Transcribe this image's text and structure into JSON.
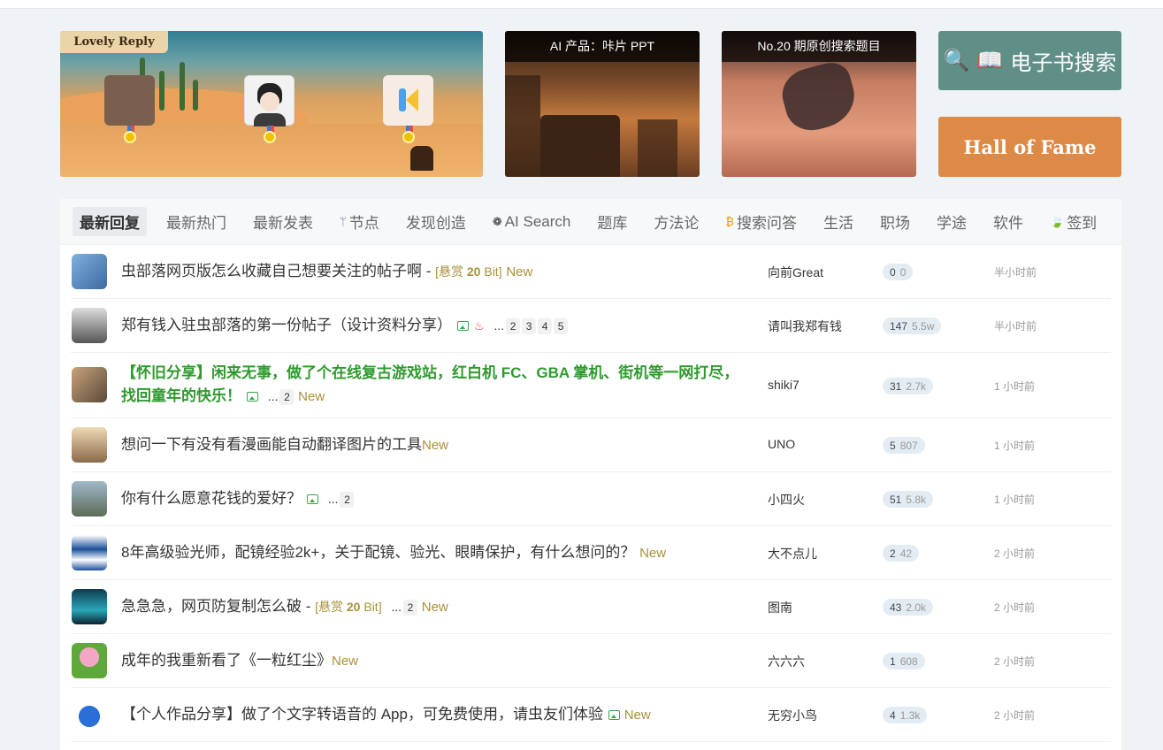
{
  "banners": {
    "main_tag": "Lovely Reply",
    "ai_caption": "AI 产品：咔片 PPT",
    "no20_caption": "No.20 期原创搜索题目"
  },
  "buttons": {
    "search_icon_glyph": "🔍",
    "book_icon_glyph": "📖",
    "ebook_search": "电子书搜索",
    "hall_of_fame": "Hall of Fame"
  },
  "tabs": [
    {
      "label": "最新回复",
      "icon": ""
    },
    {
      "label": "最新热门",
      "icon": ""
    },
    {
      "label": "最新发表",
      "icon": ""
    },
    {
      "label": "节点",
      "icon": "branch-icon",
      "glyph": "ᛘ"
    },
    {
      "label": "发现创造",
      "icon": ""
    },
    {
      "label": "AI Search",
      "icon": "ai-icon",
      "glyph": "❁"
    },
    {
      "label": "题库",
      "icon": ""
    },
    {
      "label": "方法论",
      "icon": ""
    },
    {
      "label": "搜索问答",
      "icon": "bitcoin-icon",
      "glyph": "₿"
    },
    {
      "label": "生活",
      "icon": ""
    },
    {
      "label": "职场",
      "icon": ""
    },
    {
      "label": "学途",
      "icon": ""
    },
    {
      "label": "软件",
      "icon": ""
    },
    {
      "label": "签到",
      "icon": "leaf-icon",
      "glyph": "🍃"
    }
  ],
  "colors": {
    "accent_green": "#5f8f86",
    "accent_orange": "#dd8a47",
    "featured_title": "#2e9a2e",
    "new_tag": "#a8913a"
  },
  "topics": [
    {
      "title": "虫部落网页版怎么收藏自己想要关注的帖子啊 - ",
      "bounty_pre": "[悬赏 ",
      "bounty_amt": "20",
      "bounty_post": " Bit]",
      "new": "New",
      "author": "向前Great",
      "replies": "0",
      "views": "0",
      "time": "半小时前"
    },
    {
      "title": "郑有钱入驻虫部落的第一份帖子（设计资料分享）",
      "dots": "...",
      "pages": [
        "2",
        "3",
        "4",
        "5"
      ],
      "author": "请叫我郑有钱",
      "replies": "147",
      "views": "5.5w",
      "time": "半小时前"
    },
    {
      "title": "【怀旧分享】闲来无事，做了个在线复古游戏站，红白机 FC、GBA 掌机、街机等一网打尽，找回童年的快乐！",
      "dots": "...",
      "pages": [
        "2"
      ],
      "new": "New",
      "author": "shiki7",
      "replies": "31",
      "views": "2.7k",
      "time": "1 小时前"
    },
    {
      "title": "想问一下有没有看漫画能自动翻译图片的工具",
      "new": "New",
      "author": "UNO",
      "replies": "5",
      "views": "807",
      "time": "1 小时前"
    },
    {
      "title": "你有什么愿意花钱的爱好？",
      "dots": "...",
      "pages": [
        "2"
      ],
      "author": "小四火",
      "replies": "51",
      "views": "5.8k",
      "time": "1 小时前"
    },
    {
      "title": "8年高级验光师，配镜经验2k+，关于配镜、验光、眼睛保护，有什么想问的？",
      "new": "New",
      "author": "大不点儿",
      "replies": "2",
      "views": "42",
      "time": "2 小时前"
    },
    {
      "title": "急急急，网页防复制怎么破 - ",
      "bounty_pre": "[悬赏 ",
      "bounty_amt": "20",
      "bounty_post": " Bit]",
      "dots": "...",
      "pages": [
        "2"
      ],
      "new": "New",
      "author": "图南",
      "replies": "43",
      "views": "2.0k",
      "time": "2 小时前"
    },
    {
      "title": "成年的我重新看了《一粒红尘》",
      "new": "New",
      "author": "六六六",
      "replies": "1",
      "views": "608",
      "time": "2 小时前"
    },
    {
      "title": "【个人作品分享】做了个文字转语音的 App，可免费使用，请虫友们体验",
      "new": "New",
      "author": "无穷小鸟",
      "replies": "4",
      "views": "1.3k",
      "time": "2 小时前"
    }
  ]
}
